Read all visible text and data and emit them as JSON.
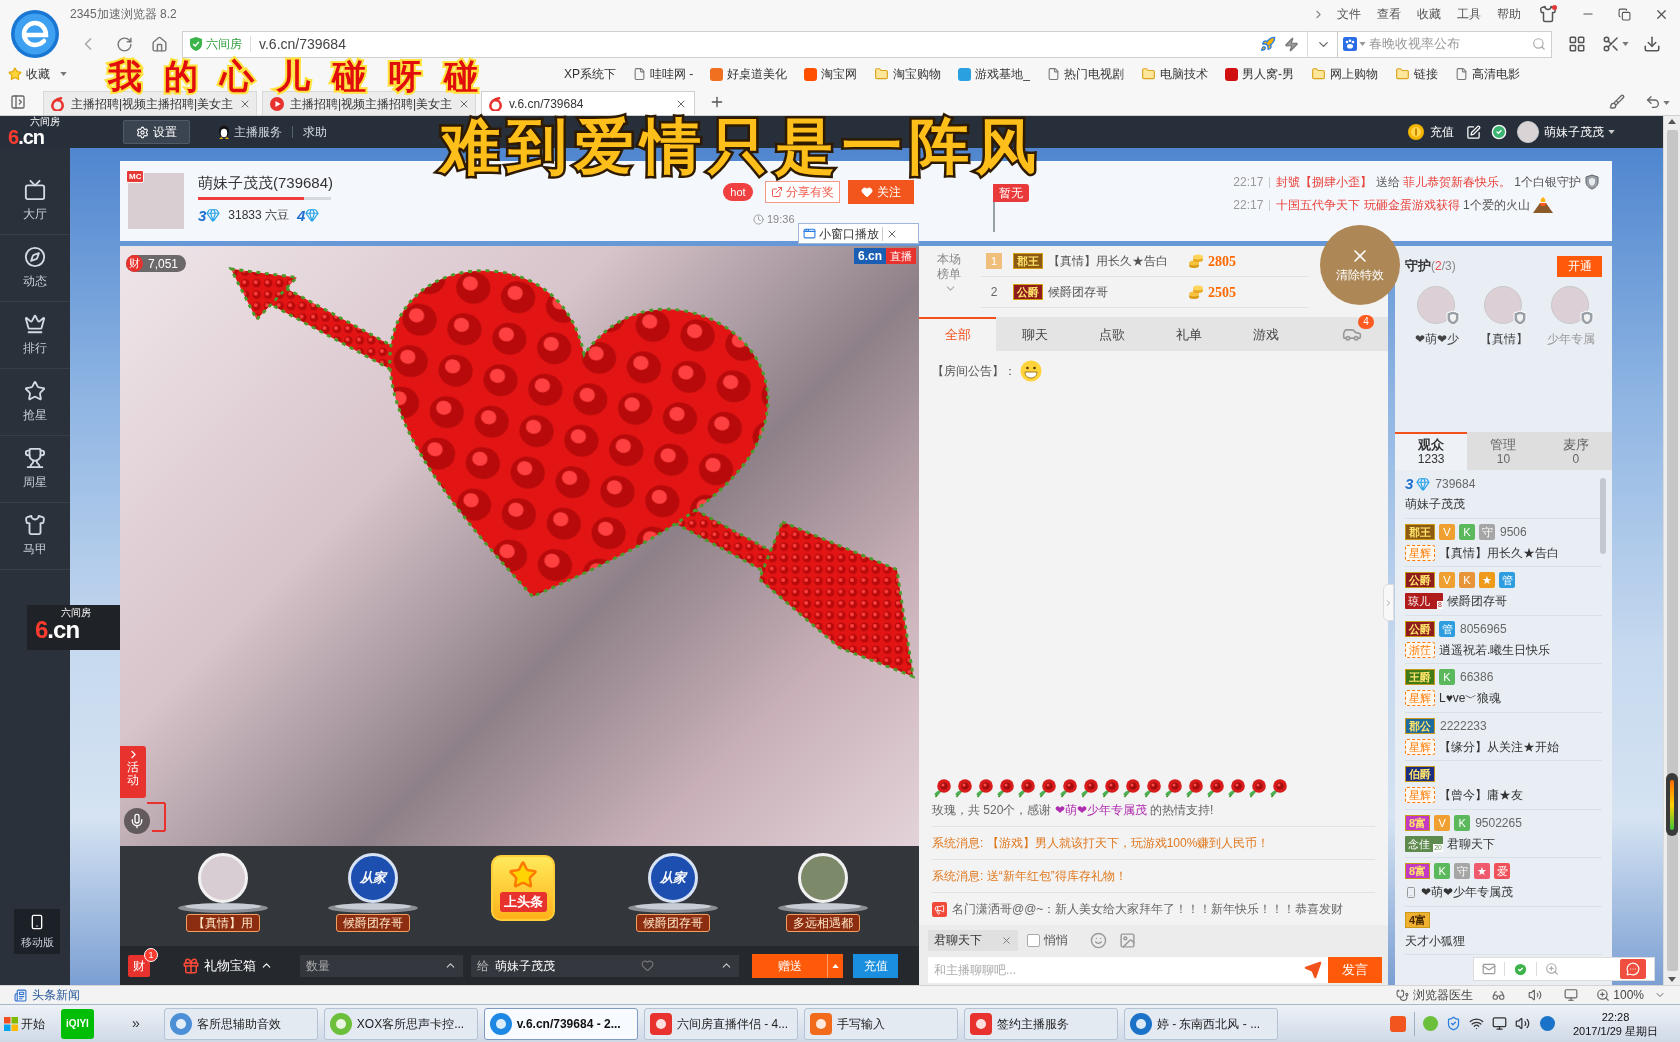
{
  "browser": {
    "title": "2345加速浏览器 8.2",
    "menu": [
      "文件",
      "查看",
      "收藏",
      "工具",
      "帮助"
    ],
    "secure_site": "六间房",
    "url": "v.6.cn/739684",
    "search": {
      "placeholder": "春晚收视率公布"
    }
  },
  "bookmarks": [
    {
      "label": "收藏",
      "kind": "favorites"
    },
    {
      "label": "XP系统下",
      "kind": "plain"
    },
    {
      "label": "哇哇网 -",
      "kind": "page"
    },
    {
      "label": "好桌道美化",
      "kind": "site",
      "color": "#f07020"
    },
    {
      "label": "淘宝网",
      "kind": "site",
      "color": "#ff5000"
    },
    {
      "label": "淘宝购物",
      "kind": "folder"
    },
    {
      "label": "游戏基地_",
      "kind": "site",
      "color": "#2aa0e0"
    },
    {
      "label": "热门电视剧",
      "kind": "page"
    },
    {
      "label": "电脑技术",
      "kind": "folder"
    },
    {
      "label": "男人窝-男",
      "kind": "site",
      "color": "#d01010"
    },
    {
      "label": "网上购物",
      "kind": "folder"
    },
    {
      "label": "链接",
      "kind": "folder"
    },
    {
      "label": "高清电影",
      "kind": "page"
    }
  ],
  "tabs": [
    {
      "label": "主播招聘|视频主播招聘|美女主",
      "kind": "logo",
      "selected": false
    },
    {
      "label": "主播招聘|视频主播招聘|美女主",
      "kind": "play",
      "selected": false
    },
    {
      "label": "v.6.cn/739684",
      "kind": "logo",
      "selected": true
    }
  ],
  "lyrics": [
    "我的心儿碰呀碰",
    "难到爱情只是一阵风"
  ],
  "site": {
    "logo": "6.cn",
    "logo_caption": "六间房",
    "nav": [
      {
        "label": "设置",
        "kind": "settings"
      },
      {
        "label": "主播服务",
        "kind": "service"
      },
      {
        "label": "求助",
        "kind": "link"
      }
    ],
    "recharge": "充值",
    "user": "萌妹子茂茂"
  },
  "sidebar": [
    {
      "label": "大厅"
    },
    {
      "label": "动态"
    },
    {
      "label": "排行"
    },
    {
      "label": "抢星"
    },
    {
      "label": "周星"
    },
    {
      "label": "马甲"
    }
  ],
  "mobile": "移动版",
  "mini_player": {
    "logo": "6.cn",
    "caption": "六间房"
  },
  "streamer": {
    "badge": "MC",
    "name": "萌妹子茂茂(739684)",
    "level": 0.8,
    "rank": "3",
    "beans": "31833 六豆",
    "next_rank": "4",
    "hot": "hot",
    "share": "分享有奖",
    "follow": "关注",
    "time": "19:36",
    "popup": "小窗口播放",
    "flag": "暂无"
  },
  "announcements": [
    {
      "time": "22:17",
      "kind": "shield",
      "parts": [
        {
          "text": "封號【捌肆小歪】",
          "highlight": true
        },
        {
          "text": " 送给 ",
          "highlight": false
        },
        {
          "text": "菲儿恭贺新春快乐。",
          "highlight": true
        },
        {
          "text": " 1个白银守护",
          "highlight": false
        }
      ]
    },
    {
      "time": "22:17",
      "kind": "volcano",
      "parts": [
        {
          "text": "十国五代争天下 玩砸金蛋游戏获得",
          "highlight": true
        },
        {
          "text": " 1个爱的火山",
          "highlight": false
        }
      ]
    }
  ],
  "video": {
    "wealth_label": "财",
    "wealth": "7,051",
    "live_logo": "6.cn",
    "live": "直播",
    "activity": "活动"
  },
  "gift_strip": [
    {
      "kind": "avatar",
      "label": "【真情】用"
    },
    {
      "kind": "emblem",
      "emblem": "从家",
      "label": "候爵团存哥"
    },
    {
      "kind": "headline",
      "label": "上头条"
    },
    {
      "kind": "emblem",
      "emblem": "从家",
      "label": "候爵团存哥"
    },
    {
      "kind": "photo",
      "label": "多远相遇都"
    }
  ],
  "gift_bar": {
    "wealth_label": "财",
    "count": "1",
    "box": "礼物宝箱",
    "quantity": {
      "placeholder": "数量"
    },
    "recipient_prefix": "给",
    "recipient": "萌妹子茂茂",
    "send": "赠送",
    "recharge": "充值"
  },
  "ranking": {
    "title": "本场榜单",
    "rows": [
      {
        "rank": "1",
        "top": true,
        "title": "郡王",
        "color": "#8c5a12",
        "name": "【真情】用长久★告白",
        "score": "2805"
      },
      {
        "rank": "2",
        "top": false,
        "title": "公爵",
        "color": "#8e1c1c",
        "name": "候爵团存哥",
        "score": "2505"
      }
    ]
  },
  "clear_effects": "清除特效",
  "chat_tabs": [
    {
      "label": "全部",
      "selected": true
    },
    {
      "label": "聊天",
      "selected": false
    },
    {
      "label": "点歌",
      "selected": false
    },
    {
      "label": "礼单",
      "selected": false
    },
    {
      "label": "游戏",
      "selected": false
    }
  ],
  "car_badge": "4",
  "chat": {
    "notice": "【房间公告】：",
    "gift": [
      {
        "text": "玫瑰，共 520个，感谢 ",
        "highlight": false
      },
      {
        "text": "❤萌❤少年专属茂",
        "highlight": true
      },
      {
        "text": " 的热情支持!",
        "highlight": false
      }
    ],
    "system": [
      "系统消息: 【游戏】男人就该打天下，玩游戏100%赚到人民币！",
      "系统消息: 送“新年红包”得库存礼物！"
    ],
    "broadcast": "名门潇洒哥@@~：新人美女给大家拜年了！！！新年快乐！！！恭喜发财"
  },
  "chat_input": {
    "target": "君聊天下",
    "whisper_label": "悄悄",
    "whisper": false,
    "placeholder": "和主播聊聊吧...",
    "send": "发言"
  },
  "guard": {
    "title": "守护",
    "count": [
      {
        "text": "(",
        "highlight": false
      },
      {
        "text": "2",
        "highlight": true
      },
      {
        "text": "/3)",
        "highlight": false
      }
    ],
    "open": "开通",
    "members": [
      "❤萌❤少",
      "【真情】",
      "少年专属"
    ]
  },
  "audience_tabs": [
    {
      "label": "观众",
      "count": "1233",
      "selected": true
    },
    {
      "label": "管理",
      "count": "10",
      "selected": false
    },
    {
      "label": "麦序",
      "count": "0",
      "selected": false
    }
  ],
  "viewers": [
    {
      "kind": "anchor",
      "rank": "3",
      "id": "739684",
      "name": "萌妹子茂茂"
    },
    {
      "kind": "user",
      "badges": [
        {
          "kind": "title",
          "text": "郡王",
          "color": "#8c5a12"
        },
        {
          "kind": "mark",
          "text": "V",
          "color": "#f0a030"
        },
        {
          "kind": "mark",
          "text": "K",
          "color": "#5cb85c"
        },
        {
          "kind": "mark",
          "text": "守",
          "color": "#a6a6a6"
        }
      ],
      "id": "9506",
      "tag": {
        "kind": "outline",
        "text": "星辉",
        "color": "#ff7a00"
      },
      "name": "【真情】用长久★告白"
    },
    {
      "kind": "user",
      "badges": [
        {
          "kind": "title",
          "text": "公爵",
          "color": "#8e1c1c"
        },
        {
          "kind": "mark",
          "text": "V",
          "color": "#f0a030"
        },
        {
          "kind": "mark",
          "text": "K",
          "color": "#e8953a"
        },
        {
          "kind": "mark",
          "text": "★",
          "color": "#f09a1a"
        },
        {
          "kind": "mark",
          "text": "管",
          "color": "#2d9de0"
        }
      ],
      "tag": {
        "kind": "filled",
        "text": "琼儿",
        "sub": "8",
        "color": "#b01c1c"
      },
      "name": "候爵团存哥"
    },
    {
      "kind": "user",
      "badges": [
        {
          "kind": "title",
          "text": "公爵",
          "color": "#8e1c1c"
        },
        {
          "kind": "mark",
          "text": "管",
          "color": "#2d9de0"
        }
      ],
      "id": "8056965",
      "tag": {
        "kind": "outline",
        "text": "浙茳",
        "color": "#ff7a00"
      },
      "name": "逍遥祝若.曦生日快乐"
    },
    {
      "kind": "user",
      "badges": [
        {
          "kind": "title",
          "text": "王爵",
          "color": "#3f7a16"
        },
        {
          "kind": "mark",
          "text": "K",
          "color": "#5cb85c"
        }
      ],
      "id": "66386",
      "tag": {
        "kind": "outline",
        "text": "星辉",
        "color": "#ff7a00"
      },
      "name": "L♥ve﹀狼魂"
    },
    {
      "kind": "user",
      "badges": [
        {
          "kind": "title",
          "text": "郡公",
          "color": "#1f6c9c"
        }
      ],
      "id": "2222233",
      "tag": {
        "kind": "outline",
        "text": "星辉",
        "color": "#ff7a00"
      },
      "name": "【缘分】从关注★开始"
    },
    {
      "kind": "user",
      "badges": [
        {
          "kind": "title",
          "text": "伯爵",
          "color": "#1c2e80"
        }
      ],
      "tag": {
        "kind": "outline",
        "text": "星辉",
        "color": "#ff7a00"
      },
      "name": "【曾今】庸★友"
    },
    {
      "kind": "user",
      "badges": [
        {
          "kind": "title",
          "text": "8富",
          "color": "#c43ac4"
        },
        {
          "kind": "mark",
          "text": "V",
          "color": "#f0a030"
        },
        {
          "kind": "mark",
          "text": "K",
          "color": "#5cb85c"
        }
      ],
      "id": "9502265",
      "tag": {
        "kind": "filled",
        "text": "念佳",
        "sub": "20",
        "color": "#5e8a4e"
      },
      "name": "君聊天下"
    },
    {
      "kind": "user",
      "badges": [
        {
          "kind": "title",
          "text": "8富",
          "color": "#c43ac4"
        },
        {
          "kind": "mark",
          "text": "K",
          "color": "#5cb85c"
        },
        {
          "kind": "mark",
          "text": "守",
          "color": "#a6a6a6"
        },
        {
          "kind": "mark",
          "text": "★",
          "color": "#f05a6e"
        },
        {
          "kind": "mark",
          "text": "爱",
          "color": "#f0505a"
        }
      ],
      "tag": {
        "kind": "mobile"
      },
      "name": "❤萌❤少年专属茂"
    },
    {
      "kind": "user",
      "badges": [
        {
          "kind": "title",
          "text": "4富",
          "color": "#f0b030"
        }
      ],
      "name": "天才小狐狸"
    }
  ],
  "status_bar": {
    "news": "头条新闻",
    "doctor": "浏览器医生",
    "zoom": "100%"
  },
  "taskbar": {
    "start": "开始",
    "pinned": "iQIYI",
    "overflow": "»",
    "items": [
      {
        "kind": "audio",
        "label": "客所思辅助音效",
        "selected": false
      },
      {
        "kind": "frog",
        "label": "XOX客所思声卡控...",
        "selected": false
      },
      {
        "kind": "browser",
        "label": "v.6.cn/739684 - 2...",
        "selected": true
      },
      {
        "kind": "studio",
        "label": "六间房直播伴侣 - 4...",
        "selected": false
      },
      {
        "kind": "ime",
        "label": "手写输入",
        "selected": false
      },
      {
        "kind": "service",
        "label": "签约主播服务",
        "selected": false
      },
      {
        "kind": "music",
        "label": "婷 - 东南西北风 - ...",
        "selected": false
      }
    ],
    "time": "22:28",
    "date": "2017/1/29 星期日"
  }
}
